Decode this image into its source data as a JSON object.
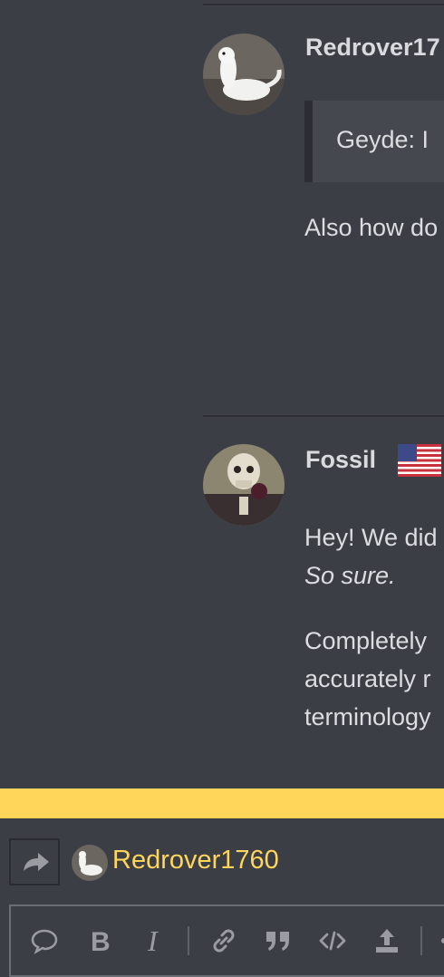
{
  "posts": [
    {
      "username": "Redrover17",
      "quote": "Geyde: I",
      "text_lines": [
        "Also how do"
      ]
    },
    {
      "username": "Fossil",
      "text_lines": [
        "Hey! We did",
        "So sure."
      ],
      "paragraph2": [
        "Completely",
        "accurately r",
        "terminology"
      ]
    }
  ],
  "reply": {
    "username": "Redrover1760"
  },
  "toolbar": {
    "tools": [
      "speech-bubble-icon",
      "bold-icon",
      "italic-icon",
      "link-icon",
      "quote-icon",
      "code-icon",
      "upload-icon"
    ]
  },
  "colors": {
    "background": "#3b3e45",
    "accent": "#ffd55a"
  }
}
